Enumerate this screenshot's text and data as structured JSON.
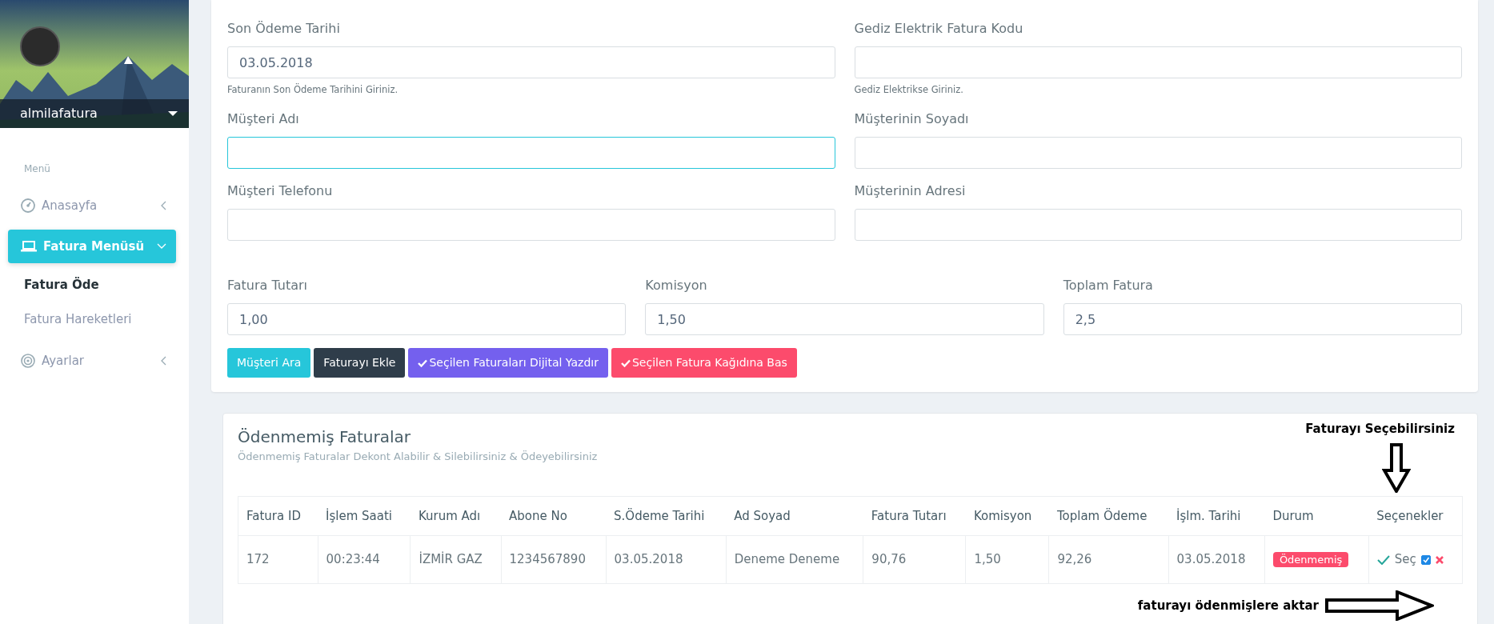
{
  "sidebar": {
    "username": "almilafatura",
    "menu_label": "Menü",
    "items": [
      {
        "label": "Anasayfa",
        "kind": "gauge",
        "selected": false,
        "expanded": false
      },
      {
        "label": "Fatura Menüsü",
        "kind": "laptop",
        "selected": true,
        "expanded": true,
        "children": [
          {
            "label": "Fatura Öde",
            "selected": true
          },
          {
            "label": "Fatura Hareketleri",
            "selected": false
          }
        ]
      },
      {
        "label": "Ayarlar",
        "kind": "target",
        "selected": false,
        "expanded": false
      }
    ]
  },
  "form": {
    "rows": [
      [
        {
          "label": "Son Ödeme Tarihi",
          "value": "03.05.2018",
          "help": "Faturanın Son Ödeme Tarihini Giriniz.",
          "focused": false
        },
        {
          "label": "Gediz Elektrik Fatura Kodu",
          "help": "Gediz Elektrikse Giriniz.",
          "focused": false
        }
      ],
      [
        {
          "label": "Müşteri Adı",
          "focused": true
        },
        {
          "label": "Müşterinin Soyadı",
          "focused": false
        }
      ],
      [
        {
          "label": "Müşteri Telefonu",
          "focused": false
        },
        {
          "label": "Müşterinin Adresi",
          "focused": false
        }
      ],
      [
        {
          "label": "Fatura Tutarı",
          "value": "1,00",
          "focused": false
        },
        {
          "label": "Komisyon",
          "value": "1,50",
          "focused": false
        },
        {
          "label": "Toplam Fatura",
          "value": "2,5",
          "focused": false
        }
      ]
    ],
    "buttons": [
      {
        "label": "Müşteri Ara",
        "kind": "info",
        "check": false
      },
      {
        "label": "Faturayı Ekle",
        "kind": "dark",
        "check": false
      },
      {
        "label": "Seçilen Faturaları Dijital Yazdır",
        "kind": "purple",
        "check": true
      },
      {
        "label": "Seçilen Fatura Kağıdına Bas",
        "kind": "danger",
        "check": true
      }
    ]
  },
  "invoices": {
    "title": "Ödenmemiş Faturalar",
    "subtitle": "Ödenmemiş Faturalar Dekont Alabilir & Silebilirsiniz & Ödeyebilirsiniz",
    "columns": [
      "Fatura ID",
      "İşlem Saati",
      "Kurum Adı",
      "Abone No",
      "S.Ödeme Tarihi",
      "Ad Soyad",
      "Fatura Tutarı",
      "Komisyon",
      "Toplam Ödeme",
      "İşlm. Tarihi",
      "Durum",
      "Seçenekler"
    ],
    "rows": [
      {
        "cells": [
          "172",
          "00:23:44",
          "İZMİR GAZ",
          "1234567890",
          "03.05.2018",
          "Deneme Deneme",
          "90,76",
          "1,50",
          "92,26",
          "03.05.2018"
        ],
        "status": "Ödenmemiş",
        "option_label": "Seç",
        "checked": true
      }
    ]
  },
  "annotations": [
    {
      "text": "Faturayı Seçebilirsiniz"
    },
    {
      "text": "faturayı ödenmişlere aktar"
    }
  ]
}
